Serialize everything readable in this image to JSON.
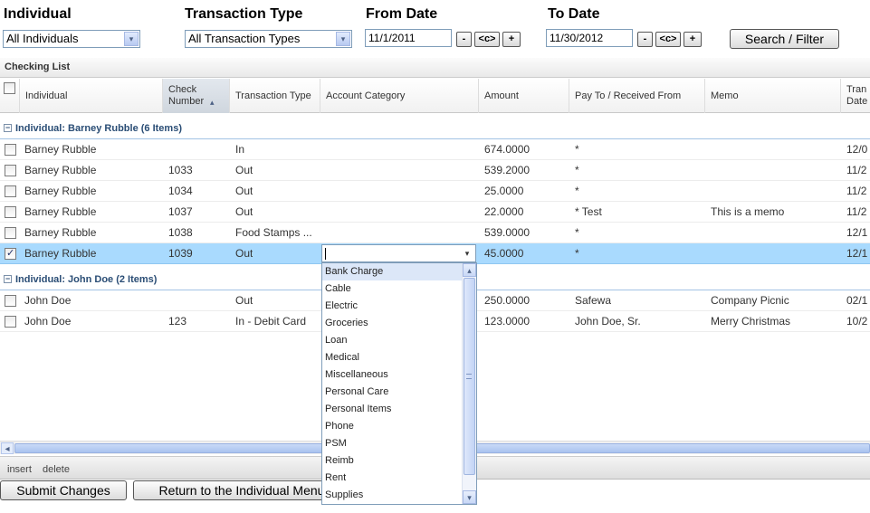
{
  "filters": {
    "individual": {
      "label": "Individual",
      "value": "All Individuals"
    },
    "transaction_type": {
      "label": "Transaction Type",
      "value": "All Transaction Types"
    },
    "from_date": {
      "label": "From Date",
      "value": "11/1/2011",
      "minus": "-",
      "center": "<c>",
      "plus": "+"
    },
    "to_date": {
      "label": "To Date",
      "value": "11/30/2012",
      "minus": "-",
      "center": "<c>",
      "plus": "+"
    },
    "search_button": "Search / Filter"
  },
  "grid": {
    "title": "Checking List",
    "columns": [
      "Individual",
      "Check Number",
      "Transaction Type",
      "Account Category",
      "Amount",
      "Pay To / Received From",
      "Memo",
      "Tran Date"
    ],
    "groups": [
      {
        "title": "Individual: Barney Rubble (6 Items)",
        "toggle": "−",
        "rows": [
          {
            "individual": "Barney Rubble",
            "check": "",
            "type": "In",
            "category": "",
            "amount": "674.0000",
            "payto": "*",
            "memo": "",
            "date": "12/0",
            "checked": false
          },
          {
            "individual": "Barney Rubble",
            "check": "1033",
            "type": "Out",
            "category": "",
            "amount": "539.2000",
            "payto": "*",
            "memo": "",
            "date": "11/2",
            "checked": false
          },
          {
            "individual": "Barney Rubble",
            "check": "1034",
            "type": "Out",
            "category": "",
            "amount": "25.0000",
            "payto": "*",
            "memo": "",
            "date": "11/2",
            "checked": false
          },
          {
            "individual": "Barney Rubble",
            "check": "1037",
            "type": "Out",
            "category": "",
            "amount": "22.0000",
            "payto": "* Test",
            "memo": "This is a memo",
            "date": "11/2",
            "checked": false
          },
          {
            "individual": "Barney Rubble",
            "check": "1038",
            "type": "Food Stamps ...",
            "category": "",
            "amount": "539.0000",
            "payto": "*",
            "memo": "",
            "date": "12/1",
            "checked": false
          },
          {
            "individual": "Barney Rubble",
            "check": "1039",
            "type": "Out",
            "category": "",
            "amount": "45.0000",
            "payto": "*",
            "memo": "",
            "date": "12/1",
            "checked": true
          }
        ]
      },
      {
        "title": "Individual: John Doe (2 Items)",
        "toggle": "−",
        "rows": [
          {
            "individual": "John Doe",
            "check": "",
            "type": "Out",
            "category": "",
            "amount": "250.0000",
            "payto": "Safewa",
            "memo": "Company Picnic",
            "date": "02/1",
            "checked": false
          },
          {
            "individual": "John Doe",
            "check": "123",
            "type": "In - Debit Card",
            "category": "",
            "amount": "123.0000",
            "payto": "John Doe, Sr.",
            "memo": "Merry Christmas",
            "date": "10/2",
            "checked": false
          }
        ]
      }
    ]
  },
  "category_dropdown": {
    "value": "",
    "options": [
      "Bank Charge",
      "Cable",
      "Electric",
      "Groceries",
      "Loan",
      "Medical",
      "Miscellaneous",
      "Personal Care",
      "Personal Items",
      "Phone",
      "PSM",
      "Reimb",
      "Rent",
      "Supplies"
    ],
    "highlighted": "Bank Charge"
  },
  "toolbar": {
    "insert": "insert",
    "delete": "delete"
  },
  "buttons": {
    "submit": "Submit Changes",
    "return": "Return to the Individual Menu"
  },
  "icons": {
    "dropdown_arrow": "▾",
    "scroll_up": "▴",
    "scroll_down": "▾",
    "scroll_left": "◂",
    "sort_asc": "▴"
  },
  "colors": {
    "selected_row": "#a9dafe",
    "group_text": "#2a4d75"
  }
}
